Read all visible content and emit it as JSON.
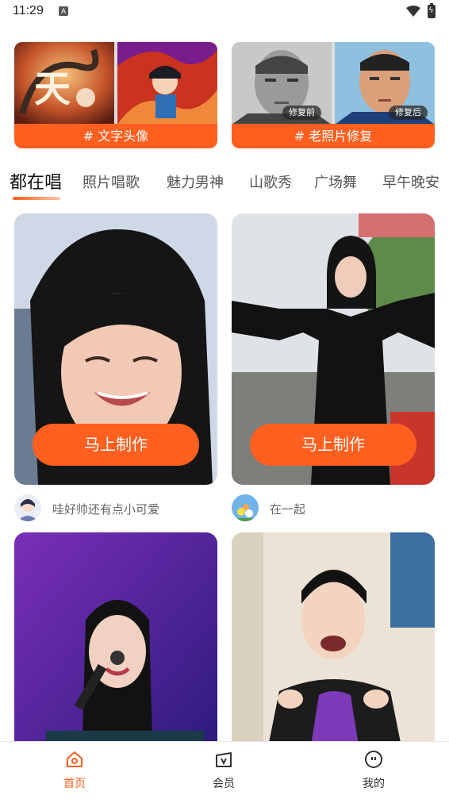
{
  "status_bar": {
    "time": "11:29",
    "notification_glyph": "A"
  },
  "features": [
    {
      "label": "# 文字头像"
    },
    {
      "label": "# 老照片修复",
      "tags": [
        "修复前",
        "修复后"
      ]
    }
  ],
  "tabs": [
    {
      "label": "都在唱",
      "active": true
    },
    {
      "label": "照片唱歌"
    },
    {
      "label": "魅力男神"
    },
    {
      "label": "山歌秀"
    },
    {
      "label": "广场舞"
    },
    {
      "label": "早午晚安"
    }
  ],
  "cards": [
    {
      "button_label": "马上制作",
      "creator": "哇好帅还有点小可爱"
    },
    {
      "button_label": "马上制作",
      "creator": "在一起"
    }
  ],
  "bottom_nav": [
    {
      "label": "首页",
      "icon": "home-icon",
      "active": true
    },
    {
      "label": "会员",
      "icon": "vip-icon"
    },
    {
      "label": "我的",
      "icon": "profile-icon"
    }
  ],
  "colors": {
    "accent": "#ff5f1f"
  }
}
